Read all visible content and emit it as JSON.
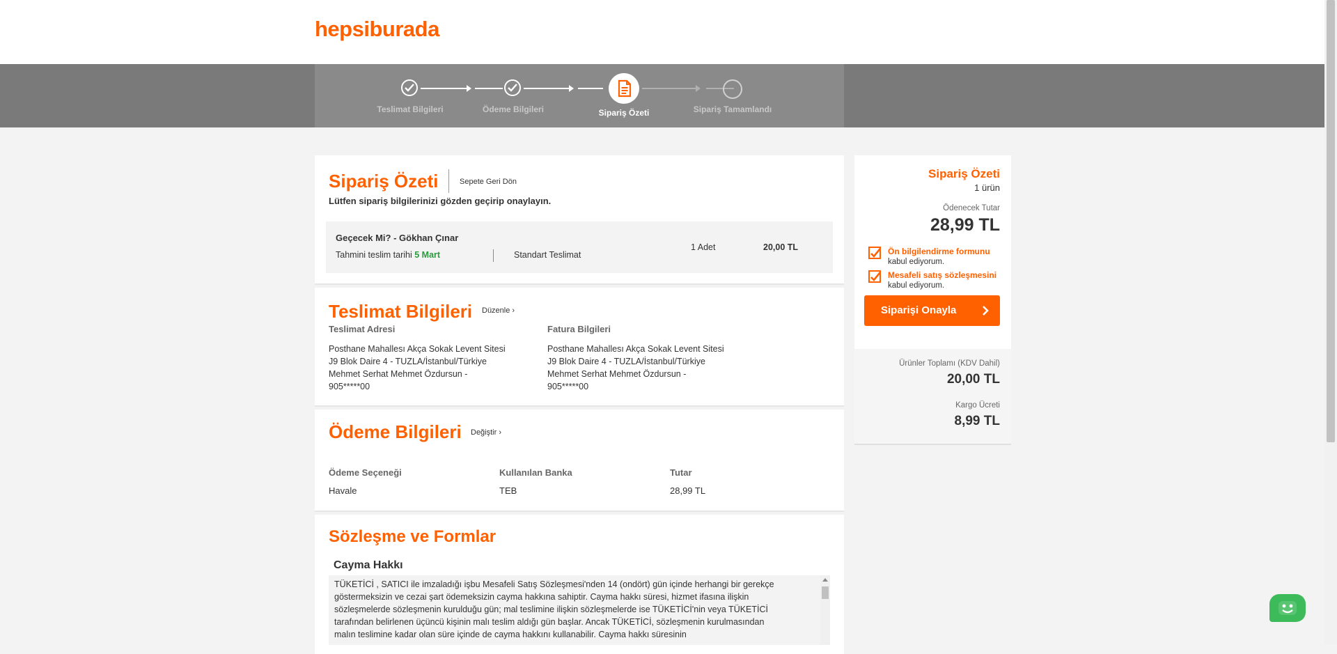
{
  "brand": {
    "logo": "hepsiburada",
    "accent": "#ff6000"
  },
  "steps": [
    {
      "label": "Teslimat Bilgileri",
      "state": "done"
    },
    {
      "label": "Ödeme Bilgileri",
      "state": "done"
    },
    {
      "label": "Sipariş Özeti",
      "state": "active"
    },
    {
      "label": "Sipariş Tamamlandı",
      "state": "pending"
    }
  ],
  "summary": {
    "title": "Sipariş Özeti",
    "back_link": "Sepete Geri Dön",
    "subtitle": "Lütfen sipariş bilgilerinizi gözden geçirip onaylayın.",
    "product": {
      "name": "Geçecek Mi? - Gökhan Çınar",
      "delivery_prefix": "Tahmini teslim tarihi",
      "delivery_date": "5 Mart",
      "shipping_type": "Standart Teslimat",
      "quantity": "1 Adet",
      "price": "20,00 TL"
    }
  },
  "delivery": {
    "title": "Teslimat Bilgileri",
    "edit_link": "Düzenle",
    "address_label": "Teslimat Adresi",
    "address_lines": [
      "Posthane Mahallesı Akça Sokak Levent Sitesi",
      "J9 Blok Daire 4 - TUZLA/İstanbul/Türkiye",
      "Mehmet Serhat Mehmet Özdursun -",
      "905*****00"
    ],
    "billing_label": "Fatura Bilgileri",
    "billing_lines": [
      "Posthane Mahallesı Akça Sokak Levent Sitesi",
      "J9 Blok Daire 4 - TUZLA/İstanbul/Türkiye",
      "Mehmet Serhat Mehmet Özdursun -",
      "905*****00"
    ]
  },
  "payment": {
    "title": "Ödeme Bilgileri",
    "change_link": "Değiştir",
    "col_option": "Ödeme Seçeneği",
    "col_bank": "Kullanılan Banka",
    "col_amount": "Tutar",
    "option": "Havale",
    "bank": "TEB",
    "amount": "28,99 TL"
  },
  "contracts": {
    "title": "Sözleşme ve Formlar",
    "section": "Cayma Hakkı",
    "text": "TÜKETİCİ , SATICI ile imzaladığı işbu Mesafeli Satış Sözleşmesi'nden 14 (ondört) gün içinde herhangi bir gerekçe göstermeksizin ve cezai şart ödemeksizin cayma hakkına sahiptir. Cayma hakkı süresi, hizmet ifasına ilişkin sözleşmelerde sözleşmenin kurulduğu gün; mal teslimine ilişkin sözleşmelerde ise TÜKETİCİ'nin veya TÜKETİCİ tarafından belirlenen üçüncü kişinin malı teslim aldığı gün başlar. Ancak TÜKETİCİ, sözleşmenin kurulmasından malın teslimine kadar olan süre içinde de cayma hakkını kullanabilir. Cayma hakkı süresinin"
  },
  "sidebar": {
    "title": "Sipariş Özeti",
    "item_count": "1 ürün",
    "payable_label": "Ödenecek Tutar",
    "payable": "28,99 TL",
    "check1_link": "Ön bilgilendirme formunu",
    "check1_suffix": "kabul ediyorum.",
    "check2_link": "Mesafeli satış sözleşmesini",
    "check2_suffix": "kabul ediyorum.",
    "confirm_button": "Siparişi Onayla",
    "products_total_label": "Ürünler Toplamı (KDV Dahil)",
    "products_total": "20,00 TL",
    "shipping_label": "Kargo Ücreti",
    "shipping": "8,99 TL"
  }
}
